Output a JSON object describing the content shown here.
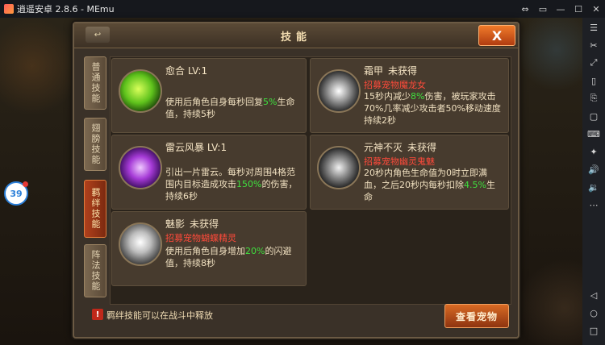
{
  "window": {
    "title": "逍遥安卓 2.8.6 - MEmu",
    "buttons": [
      "⇔",
      "▭",
      "—",
      "☐",
      "✕"
    ]
  },
  "sidebar": {
    "icons": [
      "menu-icon",
      "scissors-icon",
      "expand-icon",
      "phone-rotate-icon",
      "screenshot-icon",
      "window-icon",
      "keyboard-icon",
      "apk-icon",
      "volume-up-icon",
      "volume-down-icon",
      "more-icon",
      "back-icon",
      "home-icon",
      "recent-apps-icon"
    ],
    "glyphs": [
      "☰",
      "✂",
      "⤢",
      "▯",
      "⎘",
      "▢",
      "⌨",
      "✦",
      "🔊",
      "🔉",
      "⋯",
      "◁",
      "○",
      "□"
    ]
  },
  "floating_badge": "39",
  "dialog": {
    "title": "技能",
    "back_label": "↩",
    "close_label": "X",
    "tabs": [
      "普通技能",
      "翅膀技能",
      "羁绊技能",
      "阵法技能"
    ],
    "active_tab": 2,
    "footer_warn": "!",
    "footer_text": "羁绊技能可以在战斗中释放",
    "view_pet_label": "查看宠物"
  },
  "skills": [
    {
      "name": "愈合 LV:1",
      "status": "",
      "source": "",
      "icon": "heal-icon",
      "desc_parts": [
        "使用后角色自身每秒回复",
        "5%",
        "生命值，持续5秒"
      ]
    },
    {
      "name": "霜甲",
      "status": "未获得",
      "source": "招募宠物魔龙女",
      "icon": "frost-armor-icon",
      "desc_parts": [
        "15秒内减少",
        "8%",
        "伤害，被玩家攻击70%几率减少攻击者50%移动速度持续2秒"
      ]
    },
    {
      "name": "雷云风暴 LV:1",
      "status": "",
      "source": "",
      "icon": "thunder-storm-icon",
      "desc_parts": [
        "引出一片雷云。每秒对周围4格范围内目标造成攻击",
        "150%",
        "的伤害，持续6秒"
      ]
    },
    {
      "name": "元神不灭",
      "status": "未获得",
      "source": "招募宠物幽灵鬼魅",
      "icon": "spirit-icon",
      "desc_parts": [
        "20秒内角色生命值为0时立即满血，之后20秒内每秒扣除",
        "4.5%",
        "生命"
      ]
    },
    {
      "name": "魅影",
      "status": "未获得",
      "source": "招募宠物蝴蝶精灵",
      "icon": "shadow-icon",
      "desc_parts": [
        "使用后角色自身增加",
        "20%",
        "的闪避值，持续8秒"
      ]
    }
  ]
}
